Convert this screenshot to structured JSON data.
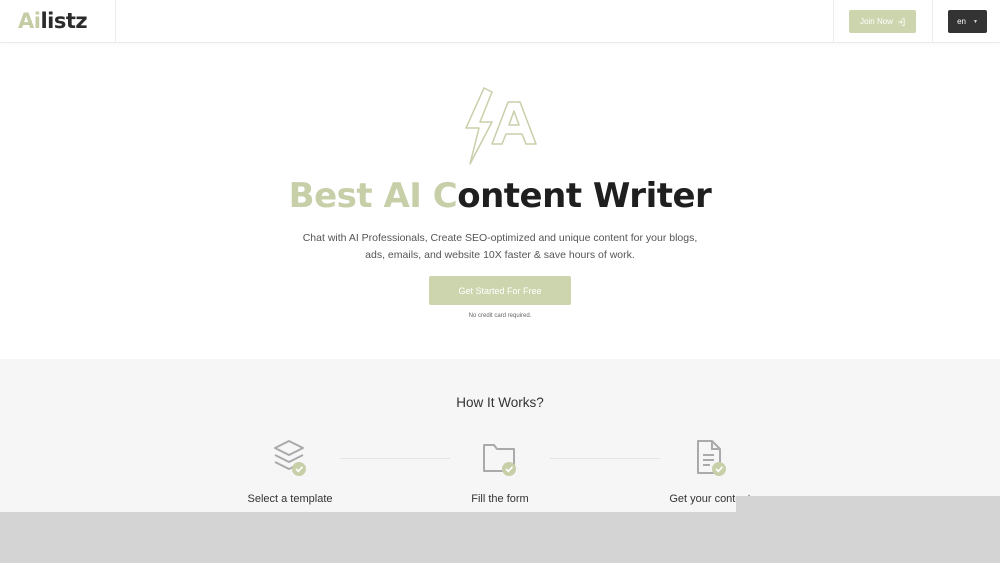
{
  "header": {
    "logo_part1": "Ai",
    "logo_part2": "listz",
    "join_label": "Join Now",
    "language": "en"
  },
  "hero": {
    "title_part1": "Best AI C",
    "title_part2": "ontent Writer",
    "subtitle": "Chat with AI Professionals, Create SEO-optimized and unique content for your blogs, ads, emails, and website 10X faster & save hours of work.",
    "cta_label": "Get Started For Free",
    "cta_note": "No credit card required."
  },
  "how_it_works": {
    "title": "How It Works?",
    "steps": [
      {
        "label": "Select a template",
        "icon": "layers-check-icon"
      },
      {
        "label": "Fill the form",
        "icon": "folder-check-icon"
      },
      {
        "label": "Get your content",
        "icon": "document-check-icon"
      }
    ]
  },
  "colors": {
    "accent": "#ccd5ae",
    "dark": "#333333",
    "section_bg": "#f6f6f6"
  }
}
